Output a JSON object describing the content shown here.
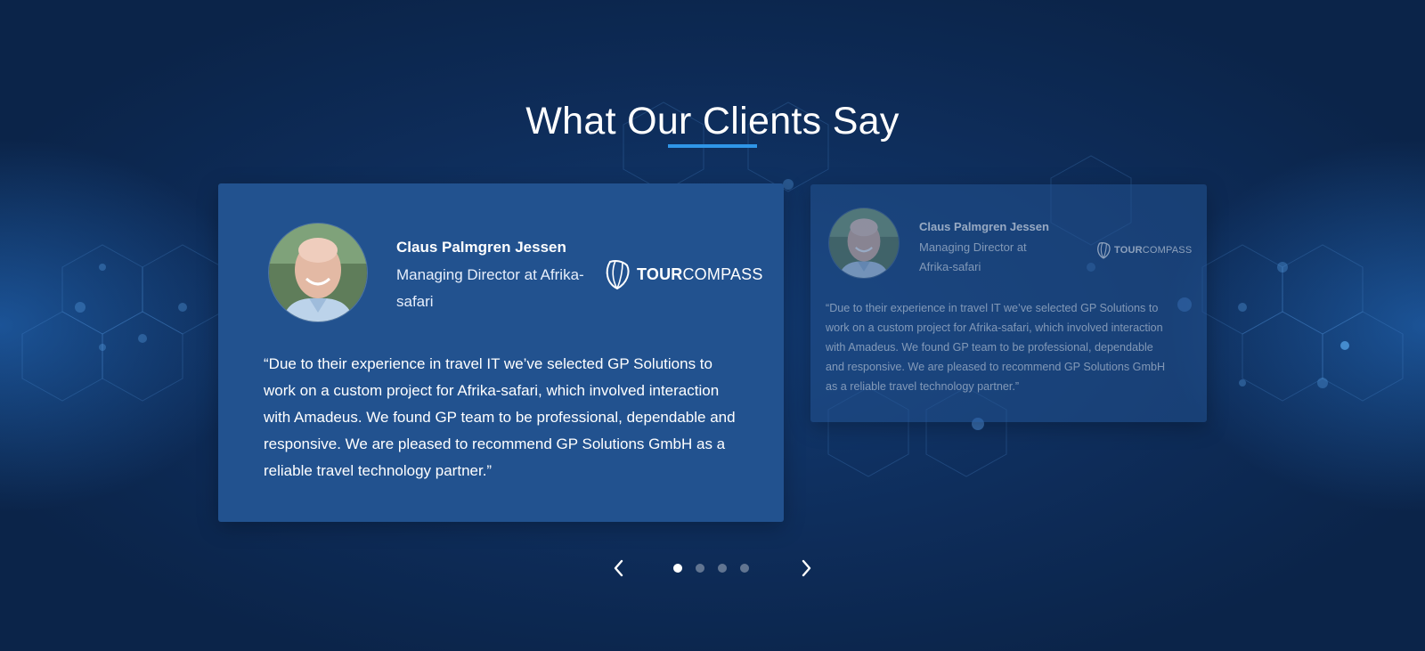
{
  "section": {
    "title": "What Our Clients Say"
  },
  "testimonials": [
    {
      "name": "Claus Palmgren Jessen",
      "role": "Managing Director at Afrika-safari",
      "company_logo": {
        "bold": "TOUR",
        "light": "COMPASS",
        "icon": "compass-shell-icon"
      },
      "quote": "“Due to their experience in travel IT we’ve selected GP Solutions to work on a custom project for Afrika-safari, which involved interaction with Amadeus. We found GP team to be professional, dependable and responsive. We are pleased to recommend GP Solutions GmbH as a reliable travel technology partner.”"
    },
    {
      "name": "Claus Palmgren Jessen",
      "role": "Managing Director at Afrika-safari",
      "company_logo": {
        "bold": "TOUR",
        "light": "COMPASS",
        "icon": "compass-shell-icon"
      },
      "quote": "“Due to their experience in travel IT we’ve selected GP Solutions to work on a custom project for Afrika-safari, which involved interaction with Amadeus. We found GP team to be professional, dependable and responsive. We are pleased to recommend GP Solutions GmbH as a reliable travel technology partner.”"
    }
  ],
  "carousel": {
    "prev_icon": "chevron-left-icon",
    "next_icon": "chevron-right-icon",
    "dot_count": 4,
    "active_index": 0
  },
  "colors": {
    "background": "#0d2a55",
    "card": "#22528f",
    "accent": "#2f96e8"
  }
}
